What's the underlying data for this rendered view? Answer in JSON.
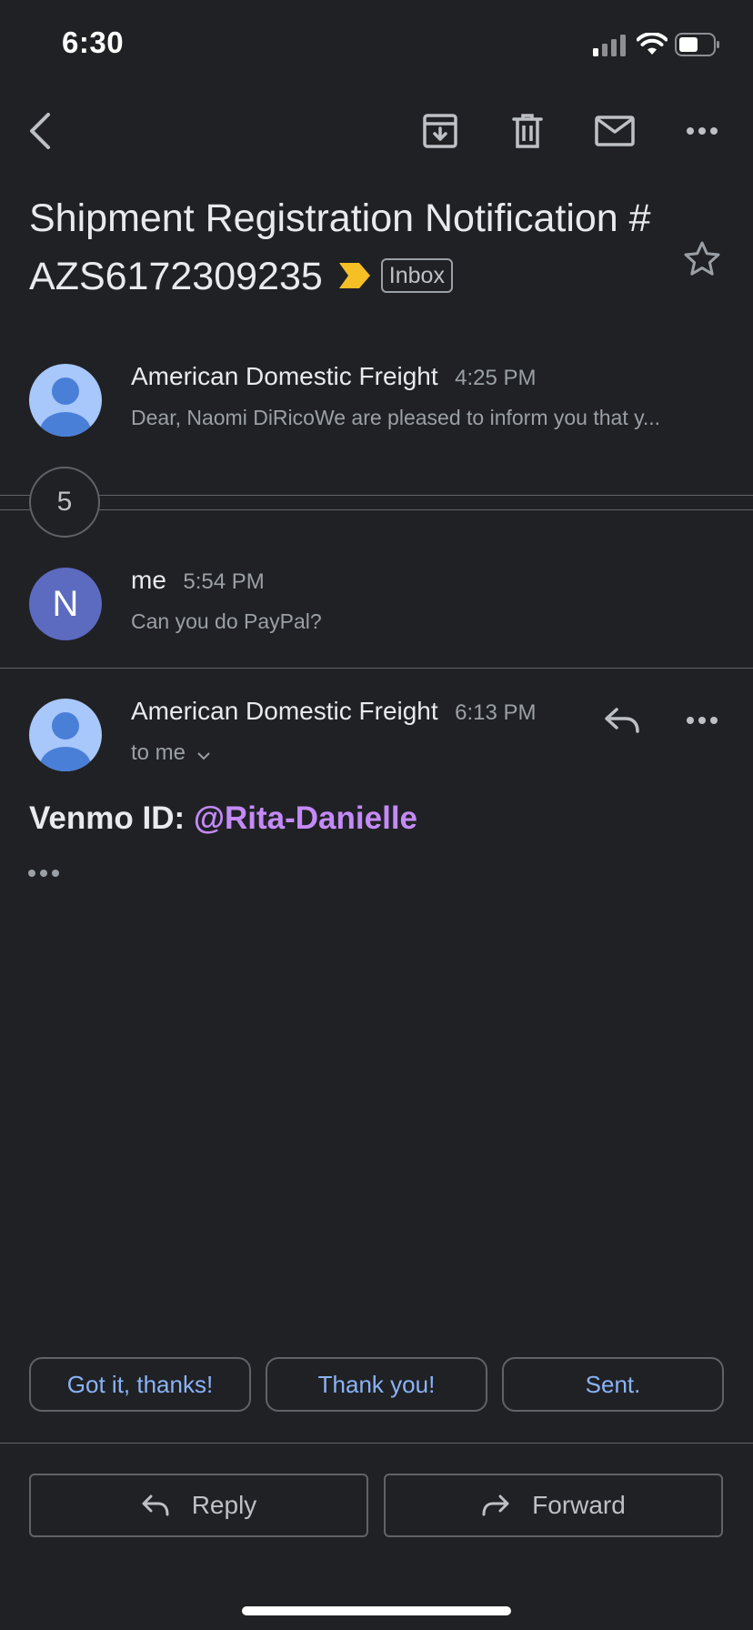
{
  "status_bar": {
    "time": "6:30"
  },
  "toolbar": {
    "back_icon": "chevron-left-icon",
    "archive_icon": "archive-icon",
    "delete_icon": "trash-icon",
    "mark_unread_icon": "mail-icon",
    "more_icon": "more-horizontal-icon"
  },
  "subject": {
    "title": "Shipment Registration Notification # AZS6172309235",
    "label": "Inbox",
    "important_color": "#f6bf26",
    "star_icon": "star-outline-icon"
  },
  "thread": {
    "messages": [
      {
        "sender": "American Domestic Freight",
        "time": "4:25 PM",
        "snippet": "Dear, Naomi DiRicoWe are pleased to inform you that y..."
      },
      {
        "collapsed_count": "5"
      },
      {
        "sender": "me",
        "avatar_letter": "N",
        "time": "5:54 PM",
        "snippet": "Can you do PayPal?"
      },
      {
        "sender": "American Domestic Freight",
        "time": "6:13 PM",
        "recipient": "to me",
        "body_label": "Venmo ID: ",
        "body_handle": "@Rita-Danielle"
      }
    ]
  },
  "smart_replies": [
    "Got it, thanks!",
    "Thank you!",
    "Sent."
  ],
  "actions": {
    "reply": "Reply",
    "forward": "Forward"
  }
}
